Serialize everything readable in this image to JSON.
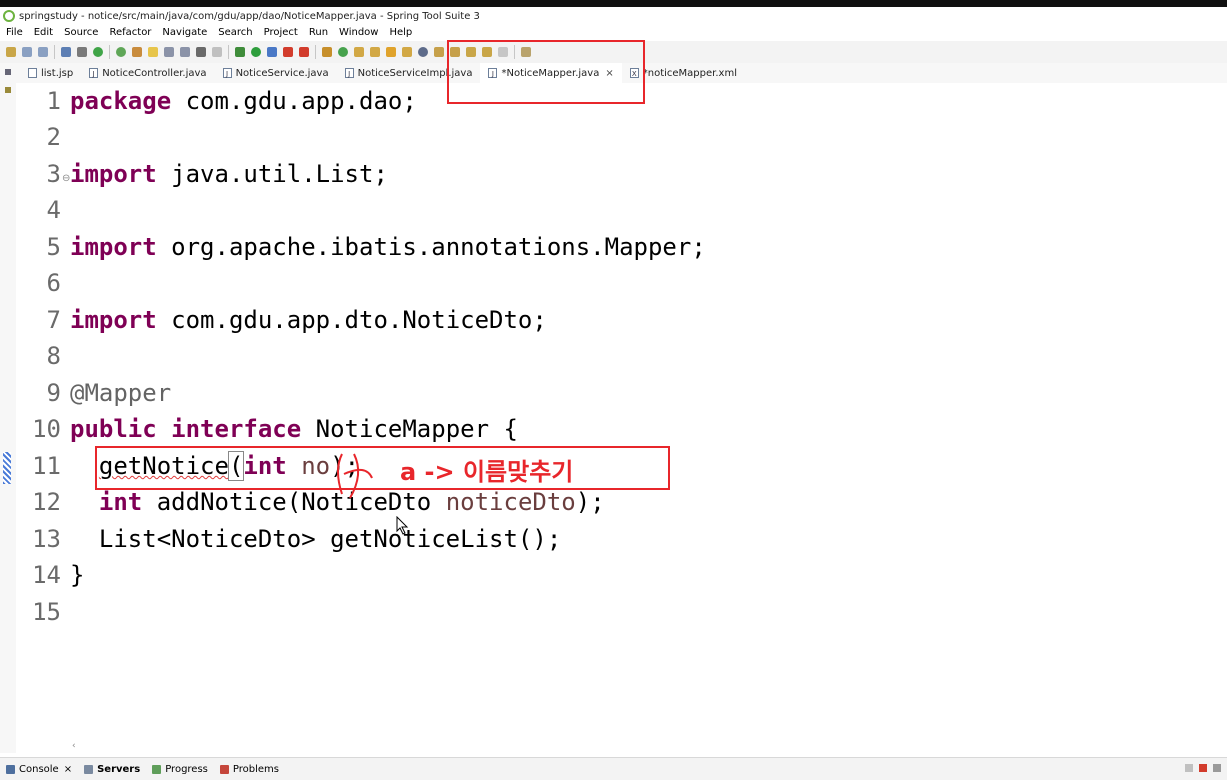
{
  "window": {
    "title": "springstudy - notice/src/main/java/com/gdu/app/dao/NoticeMapper.java - Spring Tool Suite 3"
  },
  "menu": [
    "File",
    "Edit",
    "Source",
    "Refactor",
    "Navigate",
    "Search",
    "Project",
    "Run",
    "Window",
    "Help"
  ],
  "tabs": [
    {
      "label": "list.jsp",
      "icon": "file-icon"
    },
    {
      "label": "NoticeController.java",
      "icon": "java-file-icon"
    },
    {
      "label": "NoticeService.java",
      "icon": "java-file-icon"
    },
    {
      "label": "NoticeServiceImpl.java",
      "icon": "java-file-icon"
    },
    {
      "label": "*NoticeMapper.java",
      "icon": "java-file-icon",
      "close": "×"
    },
    {
      "label": "*noticeMapper.xml",
      "icon": "xml-file-icon"
    }
  ],
  "editor": {
    "line_numbers": [
      "1",
      "2",
      "3",
      "4",
      "5",
      "6",
      "7",
      "8",
      "9",
      "10",
      "11",
      "12",
      "13",
      "14",
      "15"
    ],
    "fold_marker": "⊖",
    "line1": {
      "kw": "package",
      "rest": " com.gdu.app.dao;"
    },
    "line3": {
      "kw": "import",
      "rest": " java.util.List;"
    },
    "line5": {
      "kw": "import",
      "rest": " org.apache.ibatis.annotations.Mapper;"
    },
    "line7": {
      "kw": "import",
      "rest": " com.gdu.app.dto.NoticeDto;"
    },
    "line9": {
      "ann": "@Mapper"
    },
    "line10": {
      "kw1": "public",
      "kw2": "interface",
      "rest": " NoticeMapper {"
    },
    "line11": {
      "indent": "  ",
      "method": "getNotice",
      "open": "(",
      "kw": "int",
      "param": " no",
      "close": ");"
    },
    "line12": {
      "indent": "  ",
      "kw": "int",
      "mid": " addNotice(NoticeDto ",
      "param": "noticeDto",
      "close": ");"
    },
    "line13": {
      "text": "  List<NoticeDto> getNoticeList();"
    },
    "line14": {
      "text": "}"
    }
  },
  "annotation_note": "a -> 이름맞추기",
  "bottom_tabs": [
    {
      "label": "Console",
      "close": "×"
    },
    {
      "label": "Servers"
    },
    {
      "label": "Progress"
    },
    {
      "label": "Problems"
    }
  ],
  "scroll_arrow": "‹"
}
